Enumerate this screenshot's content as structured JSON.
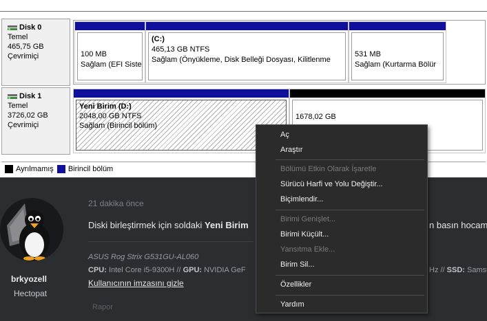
{
  "disk_management": {
    "disks": [
      {
        "name": "Disk 0",
        "type": "Temel",
        "size": "465,75 GB",
        "status": "Çevrimiçi",
        "partitions": [
          {
            "title": "",
            "size_fs": "100 MB",
            "status": "Sağlam (EFI Siste"
          },
          {
            "title": "(C:)",
            "size_fs": "465,13 GB NTFS",
            "status": "Sağlam (Önyükleme, Disk Belleği Dosyası, Kilitlenme"
          },
          {
            "title": "",
            "size_fs": "531 MB",
            "status": "Sağlam (Kurtarma Bölür"
          }
        ]
      },
      {
        "name": "Disk 1",
        "type": "Temel",
        "size": "3726,02 GB",
        "status": "Çevrimiçi",
        "partitions": [
          {
            "title": "Yeni Birim  (D:)",
            "size_fs": "2048,00 GB NTFS",
            "status": "Sağlam (Birincil bölüm)"
          },
          {
            "title": "",
            "size_fs": "1678,02 GB",
            "status": ""
          }
        ]
      }
    ],
    "legend": {
      "unallocated": "Ayrılmamış",
      "primary": "Birincil bölüm"
    },
    "colors": {
      "primary": "#10109a",
      "unallocated": "#000000"
    }
  },
  "context_menu": {
    "items": [
      {
        "label": "Aç",
        "enabled": true
      },
      {
        "label": "Araştır",
        "enabled": true
      },
      {
        "label": "Bölümü Etkin Olarak İşaretle",
        "enabled": false
      },
      {
        "label": "Sürücü Harfi ve Yolu Değiştir...",
        "enabled": true
      },
      {
        "label": "Biçimlendir...",
        "enabled": true
      },
      {
        "label": "Birimi Genişlet...",
        "enabled": false
      },
      {
        "label": "Birimi Küçült...",
        "enabled": true
      },
      {
        "label": "Yansıtma Ekle...",
        "enabled": false
      },
      {
        "label": "Birim Sil...",
        "enabled": true
      },
      {
        "label": "Özellikler",
        "enabled": true
      },
      {
        "label": "Yardım",
        "enabled": true
      }
    ]
  },
  "forum": {
    "time": "21 dakika önce",
    "message_start": "Diski birleştirmek için soldaki ",
    "message_bold": "Yeni Birim",
    "message_end": "n basın hocam.",
    "signature": {
      "model": "ASUS Rog Strix G531GU-AL060",
      "cpu_label": "CPU:",
      "cpu_value": " Intel Core i5-9300H // ",
      "gpu_label": "GPU:",
      "gpu_value": " NVIDIA GeF",
      "tail_value": "Hz // ",
      "ssd_label": "SSD:",
      "ssd_value": " Samsu",
      "hide_link": "Kullanıcının imzasını gizle"
    },
    "user": {
      "name": "brkyozell",
      "title": "Hectopat"
    },
    "report": "Rapor"
  }
}
